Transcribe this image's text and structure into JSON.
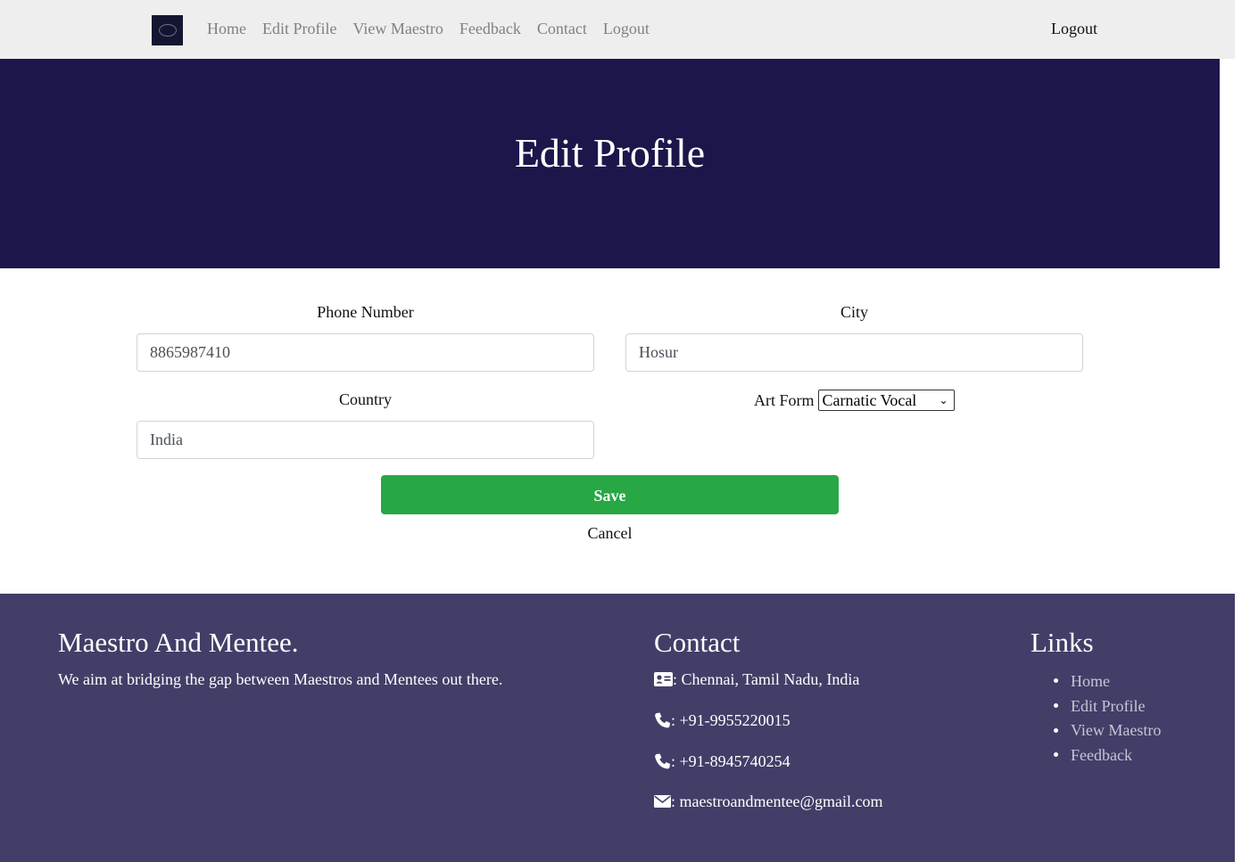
{
  "nav": {
    "links": [
      "Home",
      "Edit Profile",
      "View Maestro",
      "Feedback",
      "Contact",
      "Logout"
    ],
    "right_link": "Logout"
  },
  "hero": {
    "title": "Edit Profile"
  },
  "form": {
    "phone_label": "Phone Number",
    "phone_value": "8865987410",
    "city_label": "City",
    "city_value": "Hosur",
    "country_label": "Country",
    "country_value": "India",
    "artform_label": "Art Form",
    "artform_selected": "Carnatic Vocal",
    "save_label": "Save",
    "cancel_label": "Cancel"
  },
  "footer": {
    "brand_title": "Maestro And Mentee.",
    "tagline": "We aim at bridging the gap between Maestros and Mentees out there.",
    "contact_title": "Contact",
    "contacts": [
      {
        "icon": "address-card-icon",
        "text": ": Chennai, Tamil Nadu, India"
      },
      {
        "icon": "phone-icon",
        "text": ": +91-9955220015"
      },
      {
        "icon": "phone-icon",
        "text": ": +91-8945740254"
      },
      {
        "icon": "envelope-icon",
        "text": ": maestroandmentee@gmail.com"
      }
    ],
    "links_title": "Links",
    "links": [
      "Home",
      "Edit Profile",
      "View Maestro",
      "Feedback"
    ]
  },
  "colors": {
    "navbar_bg": "#eeeeee",
    "hero_bg": "#1b174b",
    "footer_bg": "#423e68",
    "save_button": "#28a745"
  }
}
